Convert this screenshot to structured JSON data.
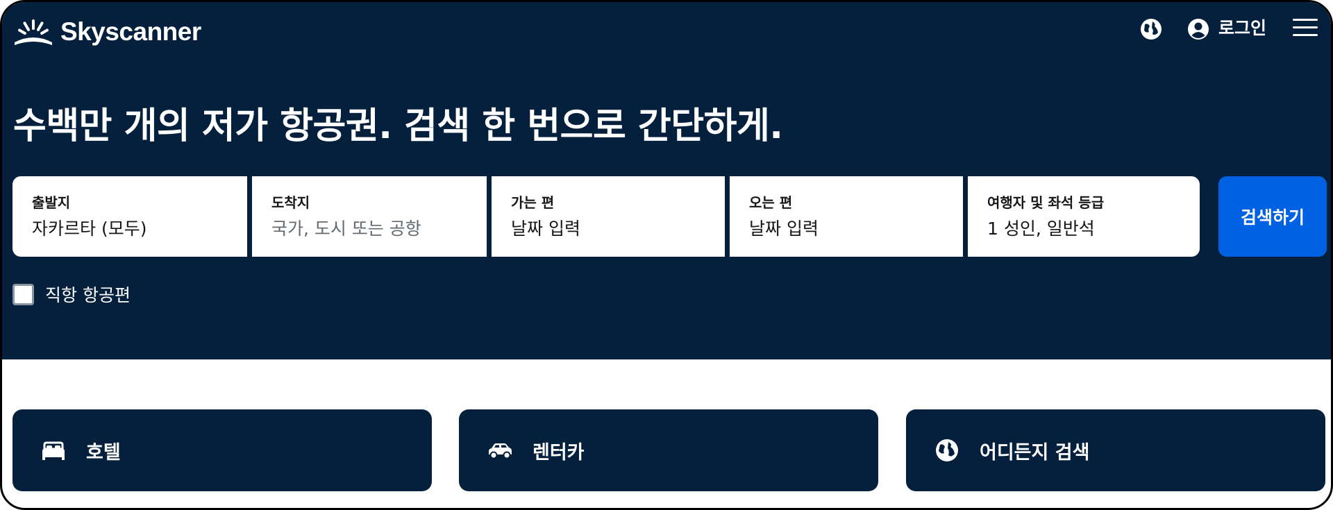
{
  "brand": {
    "name": "Skyscanner"
  },
  "header": {
    "login_label": "로그인",
    "icons": [
      "globe-icon",
      "user-icon",
      "menu-icon"
    ]
  },
  "hero": {
    "headline": "수백만 개의 저가 항공권. 검색 한 번으로 간단하게."
  },
  "search": {
    "origin": {
      "label": "출발지",
      "value": "자카르타 (모두)"
    },
    "destination": {
      "label": "도착지",
      "placeholder": "국가, 도시 또는 공항"
    },
    "depart": {
      "label": "가는 편",
      "placeholder": "날짜 입력"
    },
    "return": {
      "label": "오는 편",
      "placeholder": "날짜 입력"
    },
    "travellers": {
      "label": "여행자 및 좌석 등급",
      "value": "1 성인, 일반석"
    },
    "button_label": "검색하기",
    "direct_only": {
      "label": "직항 항공편",
      "checked": false
    }
  },
  "categories": [
    {
      "label": "호텔",
      "icon": "bed-icon"
    },
    {
      "label": "렌터카",
      "icon": "car-icon"
    },
    {
      "label": "어디든지 검색",
      "icon": "globe-icon"
    }
  ],
  "colors": {
    "brand_navy": "#05203c",
    "accent_blue": "#0062e3",
    "white": "#ffffff"
  }
}
